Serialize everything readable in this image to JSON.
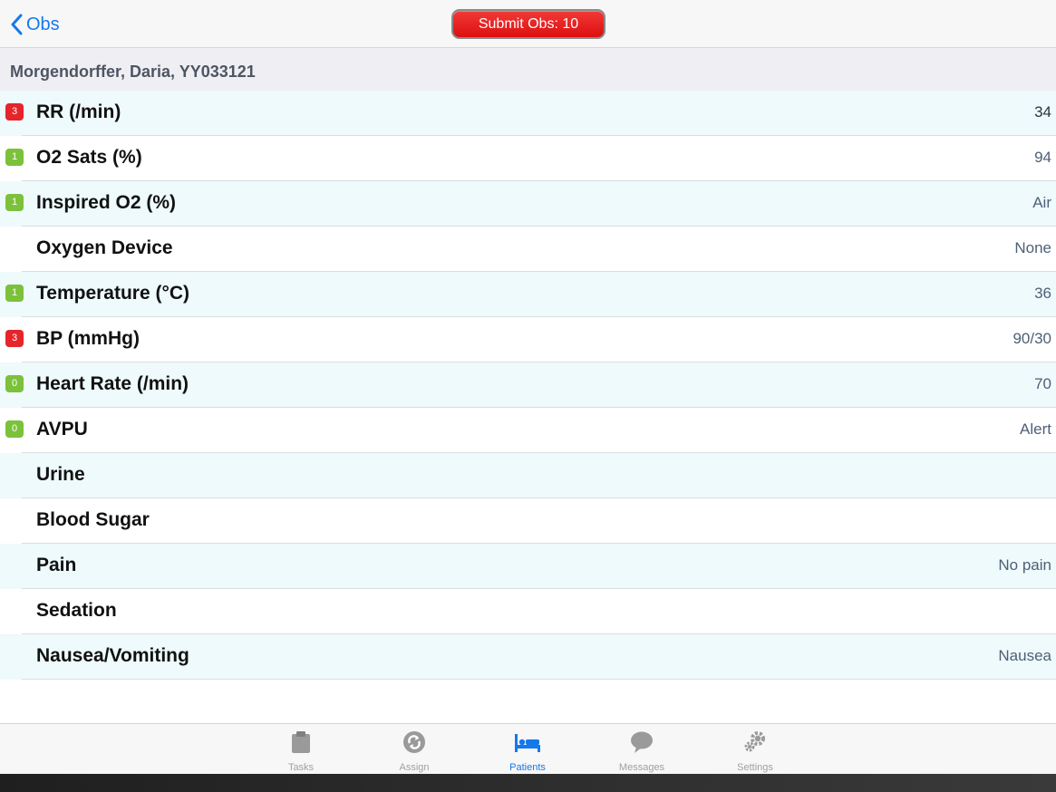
{
  "nav": {
    "back_label": "Obs",
    "submit_label": "Submit Obs: 10"
  },
  "patient": {
    "header": "Morgendorffer, Daria, YY033121"
  },
  "observations": [
    {
      "label": "RR (/min)",
      "value": "34",
      "score": "3",
      "score_color": "#e5252a"
    },
    {
      "label": "O2 Sats (%)",
      "value": "94",
      "score": "1",
      "score_color": "#7cc13b"
    },
    {
      "label": "Inspired O2 (%)",
      "value": "Air",
      "score": "1",
      "score_color": "#7cc13b"
    },
    {
      "label": "Oxygen Device",
      "value": "None",
      "score": "",
      "score_color": ""
    },
    {
      "label": "Temperature (°C)",
      "value": "36",
      "score": "1",
      "score_color": "#7cc13b"
    },
    {
      "label": "BP (mmHg)",
      "value": "90/30",
      "score": "3",
      "score_color": "#e5252a"
    },
    {
      "label": "Heart Rate (/min)",
      "value": "70",
      "score": "0",
      "score_color": "#7cc13b"
    },
    {
      "label": "AVPU",
      "value": "Alert",
      "score": "0",
      "score_color": "#7cc13b"
    },
    {
      "label": "Urine",
      "value": "",
      "score": "",
      "score_color": ""
    },
    {
      "label": "Blood Sugar",
      "value": "",
      "score": "",
      "score_color": ""
    },
    {
      "label": "Pain",
      "value": "No pain",
      "score": "",
      "score_color": ""
    },
    {
      "label": "Sedation",
      "value": "",
      "score": "",
      "score_color": ""
    },
    {
      "label": "Nausea/Vomiting",
      "value": "Nausea",
      "score": "",
      "score_color": ""
    }
  ],
  "tabs": [
    {
      "label": "Tasks",
      "icon": "clipboard-icon"
    },
    {
      "label": "Assign",
      "icon": "refresh-icon"
    },
    {
      "label": "Patients",
      "icon": "bed-icon"
    },
    {
      "label": "Messages",
      "icon": "chat-bubble-icon"
    },
    {
      "label": "Settings",
      "icon": "gears-icon"
    }
  ],
  "colors": {
    "accent": "#1479ea",
    "alert_red": "#e5252a",
    "ok_green": "#7cc13b",
    "row_alt": "#eefafc"
  }
}
